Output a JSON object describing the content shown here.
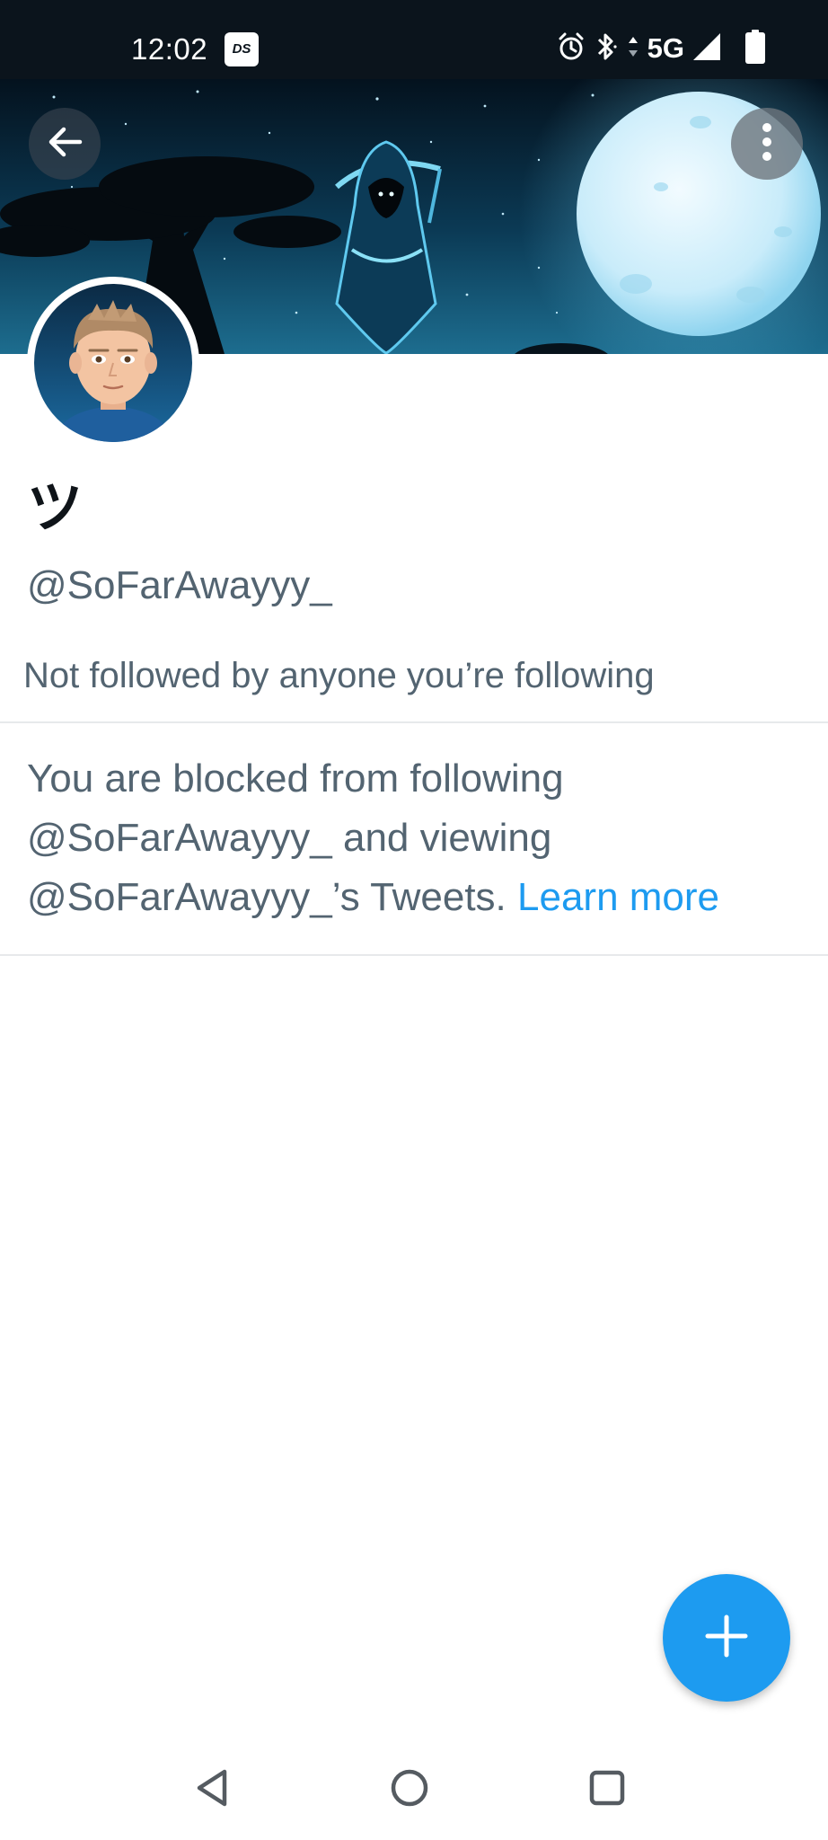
{
  "status_bar": {
    "time": "12:02",
    "app_icon_label": "DS",
    "network": "5G"
  },
  "header": {
    "back_icon": "arrow-left-icon",
    "more_icon": "more-vertical-icon"
  },
  "profile": {
    "display_name": "ツ",
    "handle": "@SoFarAwayyy_",
    "followed_by": "Not followed by anyone you’re following"
  },
  "blocked_notice": {
    "text": "You are blocked from following @SoFarAwayyy_ and viewing @SoFarAwayyy_’s Tweets. ",
    "link": "Learn more"
  },
  "fab": {
    "icon": "plus-icon"
  },
  "nav_bar": {
    "back_icon": "triangle-back-icon",
    "home_icon": "circle-home-icon",
    "recents_icon": "square-recents-icon"
  },
  "colors": {
    "accent": "#1d9bf0",
    "secondary_text": "#536471",
    "primary_text": "#0f1419",
    "status_bar_bg": "#0b141c",
    "divider": "#e7e9eb"
  }
}
